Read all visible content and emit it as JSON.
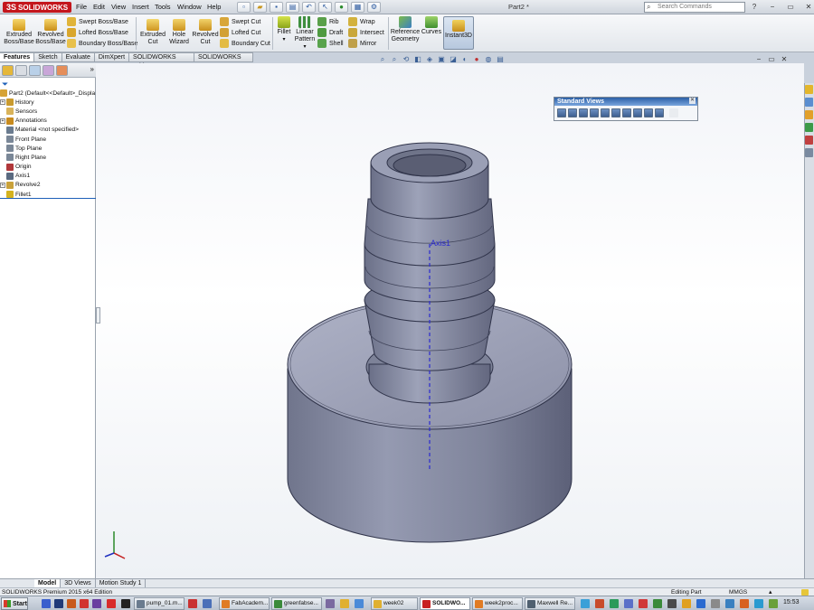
{
  "app": {
    "brand": "SOLIDWORKS",
    "brand_prefix": "3S",
    "menus": [
      "File",
      "Edit",
      "View",
      "Insert",
      "Tools",
      "Window",
      "Help"
    ],
    "document_title": "Part2 *",
    "search_placeholder": "Search Commands",
    "help_label": "?"
  },
  "ribbon": {
    "extruded_boss": "Extruded Boss/Base",
    "revolved_boss": "Revolved Boss/Base",
    "swept_boss": "Swept Boss/Base",
    "lofted_boss": "Lofted Boss/Base",
    "boundary_boss": "Boundary Boss/Base",
    "extruded_cut": "Extruded Cut",
    "hole_wizard": "Hole Wizard",
    "revolved_cut": "Revolved Cut",
    "swept_cut": "Swept Cut",
    "lofted_cut": "Lofted Cut",
    "boundary_cut": "Boundary Cut",
    "fillet": "Fillet",
    "linear_pattern": "Linear Pattern",
    "rib": "Rib",
    "draft": "Draft",
    "shell": "Shell",
    "wrap": "Wrap",
    "intersect": "Intersect",
    "mirror": "Mirror",
    "reference_geometry": "Reference Geometry",
    "curves": "Curves",
    "instant3d": "Instant3D"
  },
  "tabs": [
    "Features",
    "Sketch",
    "Evaluate",
    "DimXpert",
    "SOLIDWORKS Add-Ins",
    "SOLIDWORKS MBD"
  ],
  "tree": {
    "root": "Part2  (Default<<Default>_Displa",
    "items": [
      {
        "label": "History",
        "icon": "history-icon",
        "expand": true,
        "color": "#c99a2e"
      },
      {
        "label": "Sensors",
        "icon": "sensors-icon",
        "expand": false,
        "color": "#d9b35a"
      },
      {
        "label": "Annotations",
        "icon": "annotations-icon",
        "expand": true,
        "color": "#c88b1e"
      },
      {
        "label": "Material <not specified>",
        "icon": "material-icon",
        "expand": false,
        "color": "#6a7b8f"
      },
      {
        "label": "Front Plane",
        "icon": "plane-icon",
        "expand": false,
        "color": "#7a8797"
      },
      {
        "label": "Top Plane",
        "icon": "plane-icon",
        "expand": false,
        "color": "#7a8797"
      },
      {
        "label": "Right Plane",
        "icon": "plane-icon",
        "expand": false,
        "color": "#7a8797"
      },
      {
        "label": "Origin",
        "icon": "origin-icon",
        "expand": false,
        "color": "#b0373a"
      },
      {
        "label": "Axis1",
        "icon": "axis-icon",
        "expand": false,
        "color": "#5a6a80"
      },
      {
        "label": "Revolve2",
        "icon": "revolve-icon",
        "expand": true,
        "color": "#c9a13a"
      },
      {
        "label": "Fillet1",
        "icon": "fillet-icon",
        "expand": false,
        "color": "#d4b21e"
      }
    ]
  },
  "viewport": {
    "axis_label": "Axis1",
    "standard_views_title": "Standard Views"
  },
  "bottom_tabs": [
    "Model",
    "3D Views",
    "Motion Study 1"
  ],
  "status": {
    "edition": "SOLIDWORKS Premium 2015 x64 Edition",
    "mode": "Editing Part",
    "units": "MMGS"
  },
  "taskbar": {
    "start": "Start",
    "tasks": [
      "pump_01.m...",
      "FabAcadem...",
      "greenfabse...",
      "week02",
      "SOLIDWO...",
      "week2proc...",
      "Maxwell Re..."
    ],
    "clock": "15:53"
  },
  "colors": {
    "ribbon_bg": "#e9ecf0",
    "tree_selection": "#1d5fb8",
    "model_fill": "#8a8fa6",
    "axis_color": "#2a2ad0",
    "header_blue": "#2b5fa6"
  }
}
